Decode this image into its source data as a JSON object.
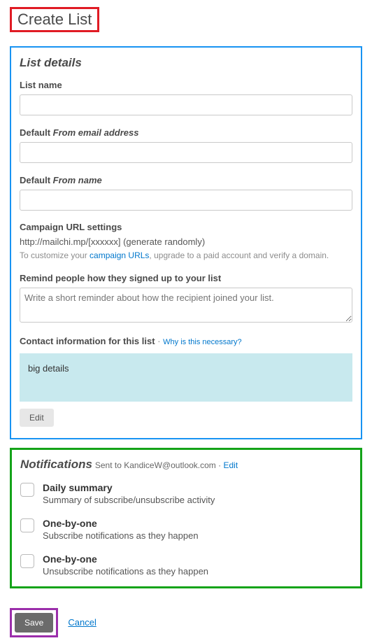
{
  "pageTitle": "Create List",
  "listDetails": {
    "heading": "List details",
    "listName": {
      "label": "List name",
      "value": ""
    },
    "fromEmail": {
      "prefix": "Default ",
      "italic": "From email address",
      "value": ""
    },
    "fromName": {
      "prefix": "Default ",
      "italic": "From name",
      "value": ""
    },
    "campaignUrl": {
      "label": "Campaign URL settings",
      "urlLine": "http://mailchi.mp/[xxxxxx] (generate randomly)",
      "hintPrefix": "To customize your ",
      "hintLink": "campaign URLs",
      "hintSuffix": ", upgrade to a paid account and verify a domain."
    },
    "reminder": {
      "label": "Remind people how they signed up to your list",
      "placeholder": "Write a short reminder about how the recipient joined your list."
    },
    "contactInfo": {
      "label": "Contact information for this list",
      "whyLink": "Why is this necessary?",
      "boxText": "big details",
      "editLabel": "Edit"
    }
  },
  "notifications": {
    "heading": "Notifications",
    "sentToPrefix": " Sent to ",
    "sentToEmail": "KandiceW@outlook.com",
    "dot": " · ",
    "editLink": "Edit",
    "items": [
      {
        "title": "Daily summary",
        "desc": "Summary of subscribe/unsubscribe activity"
      },
      {
        "title": "One-by-one",
        "desc": "Subscribe notifications as they happen"
      },
      {
        "title": "One-by-one",
        "desc": "Unsubscribe notifications as they happen"
      }
    ]
  },
  "actions": {
    "save": "Save",
    "cancel": "Cancel"
  }
}
